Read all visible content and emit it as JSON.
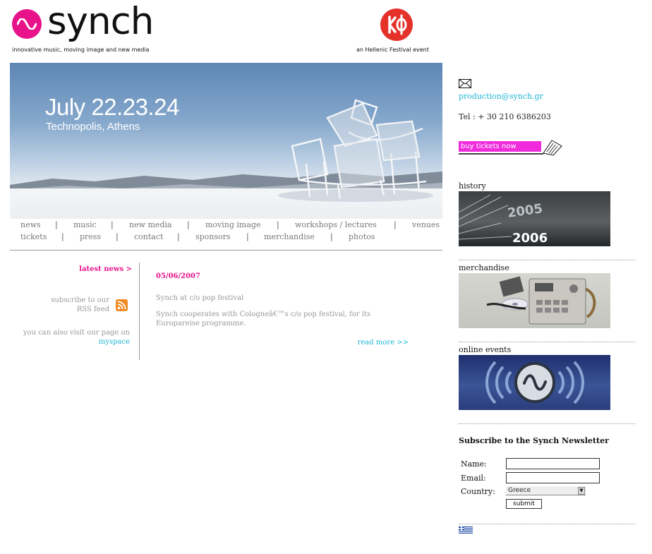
{
  "header": {
    "logo_word": "synch",
    "logo_tagline": "innovative music, moving image and new media",
    "festival_tagline": "an Hellenic Festival event"
  },
  "banner": {
    "date": "July 22.23.24",
    "place": "Technopolis, Athens"
  },
  "nav": {
    "row1": [
      "news",
      "music",
      "new media",
      "moving image",
      "workshops / lectures",
      "venues"
    ],
    "row2": [
      "tickets",
      "press",
      "contact",
      "sponsors",
      "merchandise",
      "photos"
    ],
    "separator": "|"
  },
  "left": {
    "latest_news": "latest news >",
    "rss_line1": "subscribe to our",
    "rss_line2": "RSS feed",
    "visit_line": "you can also visit our page on",
    "myspace": "myspace"
  },
  "news": {
    "date": "05/06/2007",
    "title": "Synch at c/o pop festival",
    "body": "Synch cooperates with Cologneâ€™s c/o pop festival, for its Europareise programme.",
    "read_more": "read more >>"
  },
  "right": {
    "email": "production@synch.gr",
    "tel": "Tel : + 30 210 6386203",
    "buy_tickets": "buy tickets now",
    "history_title": "history",
    "history_year1": "2005",
    "history_year2": "2006",
    "merch_title": "merchandise",
    "online_title": "online events",
    "newsletter_title": "Subscribe to the Synch Newsletter",
    "name_label": "Name:",
    "email_label": "Email:",
    "country_label": "Country:",
    "country_value": "Greece",
    "submit_label": "submit"
  },
  "colors": {
    "brand_pink": "#e8128a",
    "festival_red": "#e4322b",
    "link_cyan": "#1fb6d6",
    "tickets_magenta": "#f02bdc"
  }
}
